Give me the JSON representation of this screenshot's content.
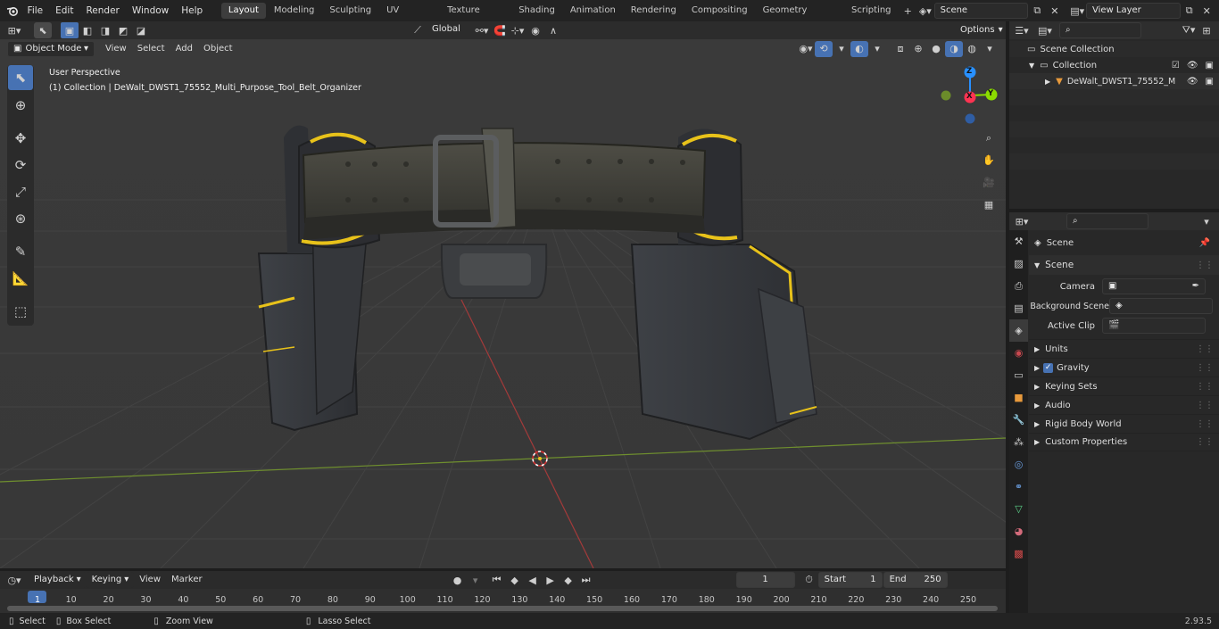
{
  "menus": [
    "File",
    "Edit",
    "Render",
    "Window",
    "Help"
  ],
  "workspaces": [
    "Layout",
    "Modeling",
    "Sculpting",
    "UV Editing",
    "Texture Paint",
    "Shading",
    "Animation",
    "Rendering",
    "Compositing",
    "Geometry Nodes",
    "Scripting"
  ],
  "active_workspace": "Layout",
  "scene_name": "Scene",
  "view_layer_name": "View Layer",
  "viewport": {
    "mode": "Object Mode",
    "header_menus": [
      "View",
      "Select",
      "Add",
      "Object"
    ],
    "transform_orientation": "Global",
    "options_label": "Options",
    "overlay_title": "User Perspective",
    "overlay_subtitle": "(1) Collection | DeWalt_DWST1_75552_Multi_Purpose_Tool_Belt_Organizer",
    "axis_x": "X",
    "axis_y": "Y",
    "axis_z": "Z"
  },
  "outliner": {
    "root": "Scene Collection",
    "collection": "Collection",
    "object": "DeWalt_DWST1_75552_M"
  },
  "properties": {
    "context": "Scene",
    "panel_title": "Scene",
    "fields": [
      {
        "label": "Camera",
        "value": ""
      },
      {
        "label": "Background Scene",
        "value": ""
      },
      {
        "label": "Active Clip",
        "value": ""
      }
    ],
    "subpanels": [
      "Units",
      "Gravity",
      "Keying Sets",
      "Audio",
      "Rigid Body World",
      "Custom Properties"
    ],
    "gravity_checked": true
  },
  "timeline": {
    "menus": [
      "Playback",
      "Keying",
      "View",
      "Marker"
    ],
    "current_frame": "1",
    "start_label": "Start",
    "start_value": "1",
    "end_label": "End",
    "end_value": "250",
    "ticks": [
      "1",
      "10",
      "20",
      "30",
      "40",
      "50",
      "60",
      "70",
      "80",
      "90",
      "100",
      "110",
      "120",
      "130",
      "140",
      "150",
      "160",
      "170",
      "180",
      "190",
      "200",
      "210",
      "220",
      "230",
      "240",
      "250"
    ]
  },
  "statusbar": {
    "hints": [
      "Select",
      "Box Select",
      "Zoom View",
      "Lasso Select"
    ],
    "version": "2.93.5"
  },
  "colors": {
    "accent": "#4772b3",
    "belt_yellow": "#e8c21a",
    "axis_red": "#ff3352",
    "axis_green": "#8bdc00",
    "axis_blue": "#2890ff"
  }
}
